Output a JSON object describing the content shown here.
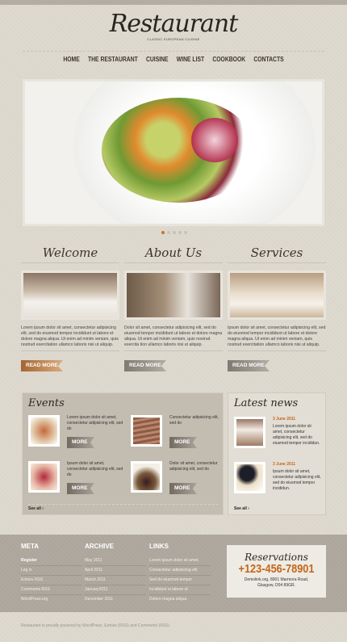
{
  "header": {
    "logo": "Restaurant",
    "tagline": "CLASSIC EUROPEAN CUISINE"
  },
  "nav": [
    "HOME",
    "THE RESTAURANT",
    "CUISINE",
    "WINE LIST",
    "COOKBOOK",
    "CONTACTS"
  ],
  "slider": {
    "slides": 5,
    "active": 0
  },
  "columns": [
    {
      "title": "Welcome",
      "text": "Lorem ipsum dolor sit amet, consectetur adipisicing elit, sed do eiusmod tempor incididunt ut labore et dolore magna aliqua. Ut enim ad minim veniam, quis nostrud exercitation ullamco laboris nisi ut aliquip.",
      "button": "READ MORE"
    },
    {
      "title": "About Us",
      "text": "Dolor sit amet, consectetur adipisicing elit, sed do eiusmod tempor incididunt ut labore et dolore magna aliqua. Ut enim ad minim veniam, quis nostrud exercita tion ullamco laboris nisi ut aliquip.",
      "button": "READ MORE"
    },
    {
      "title": "Services",
      "text": "Ipsum dolor sit amet, consectetur adipisicing elit, sed do eiusmod tempor incididunt ut labore et dolore magna aliqua. Ut enim ad minim veniam, quis nostrud exercitation ullamco laboris nisi ut aliquip.",
      "button": "READ MORE"
    }
  ],
  "events": {
    "title": "Events",
    "see_all": "See all ›",
    "items": [
      {
        "text": "Lorem ipsum dolor sit amet, consectetur adipisicing elit, sed do",
        "button": "MORE"
      },
      {
        "text": "Consectetur adipisicing elit, sed do",
        "button": "MORE"
      },
      {
        "text": "Ipsum dolor sit amet, consectetur adipisicing elit, sed do",
        "button": "MORE"
      },
      {
        "text": "Dolor sit amet, consectetur adipisicing elit, sed do",
        "button": "MORE"
      }
    ]
  },
  "news": {
    "title": "Latest news",
    "see_all": "See all ›",
    "items": [
      {
        "date": "3 June 2011",
        "text": "Lorem ipsum dolor sit amet, consectetur adipisicing elit, sed do eiusmod tempor incididun."
      },
      {
        "date": "3 June 2011",
        "text": "Ipsum dolor sit amet, consectetur adipisicing elit, sed do eiusmod tempor incididun."
      }
    ]
  },
  "footer": {
    "meta": {
      "title": "META",
      "items": [
        "Register",
        "Log in",
        "Entries RSS",
        "Comments RSS",
        "WordPress.org"
      ]
    },
    "archive": {
      "title": "ARCHIVE",
      "items": [
        "May 2011",
        "April 2011",
        "March 2011",
        "January2011",
        "December 2011"
      ]
    },
    "links": {
      "title": "LINKS",
      "items": [
        "Lorem ipsum dolor sit amet,",
        "Consectetur adipisicing elit",
        "Sed do eiusmod tempor",
        "Incididunt ut labore et",
        "Dolore magna aliqua"
      ]
    },
    "reservations": {
      "title": "Reservations",
      "phone": "+123-456-78901",
      "address1": "Demolink.org, 8901 Marmora Road,",
      "address2": "Glasgow, D04 89GR."
    },
    "copyright": "Restaurant is proudly powered by WordPress. Entries (RSS) and Comments (RSS)"
  },
  "colors": {
    "accent": "#c5661c",
    "footer_bg": "#aca69c",
    "page_bg": "#dcd7cc"
  }
}
